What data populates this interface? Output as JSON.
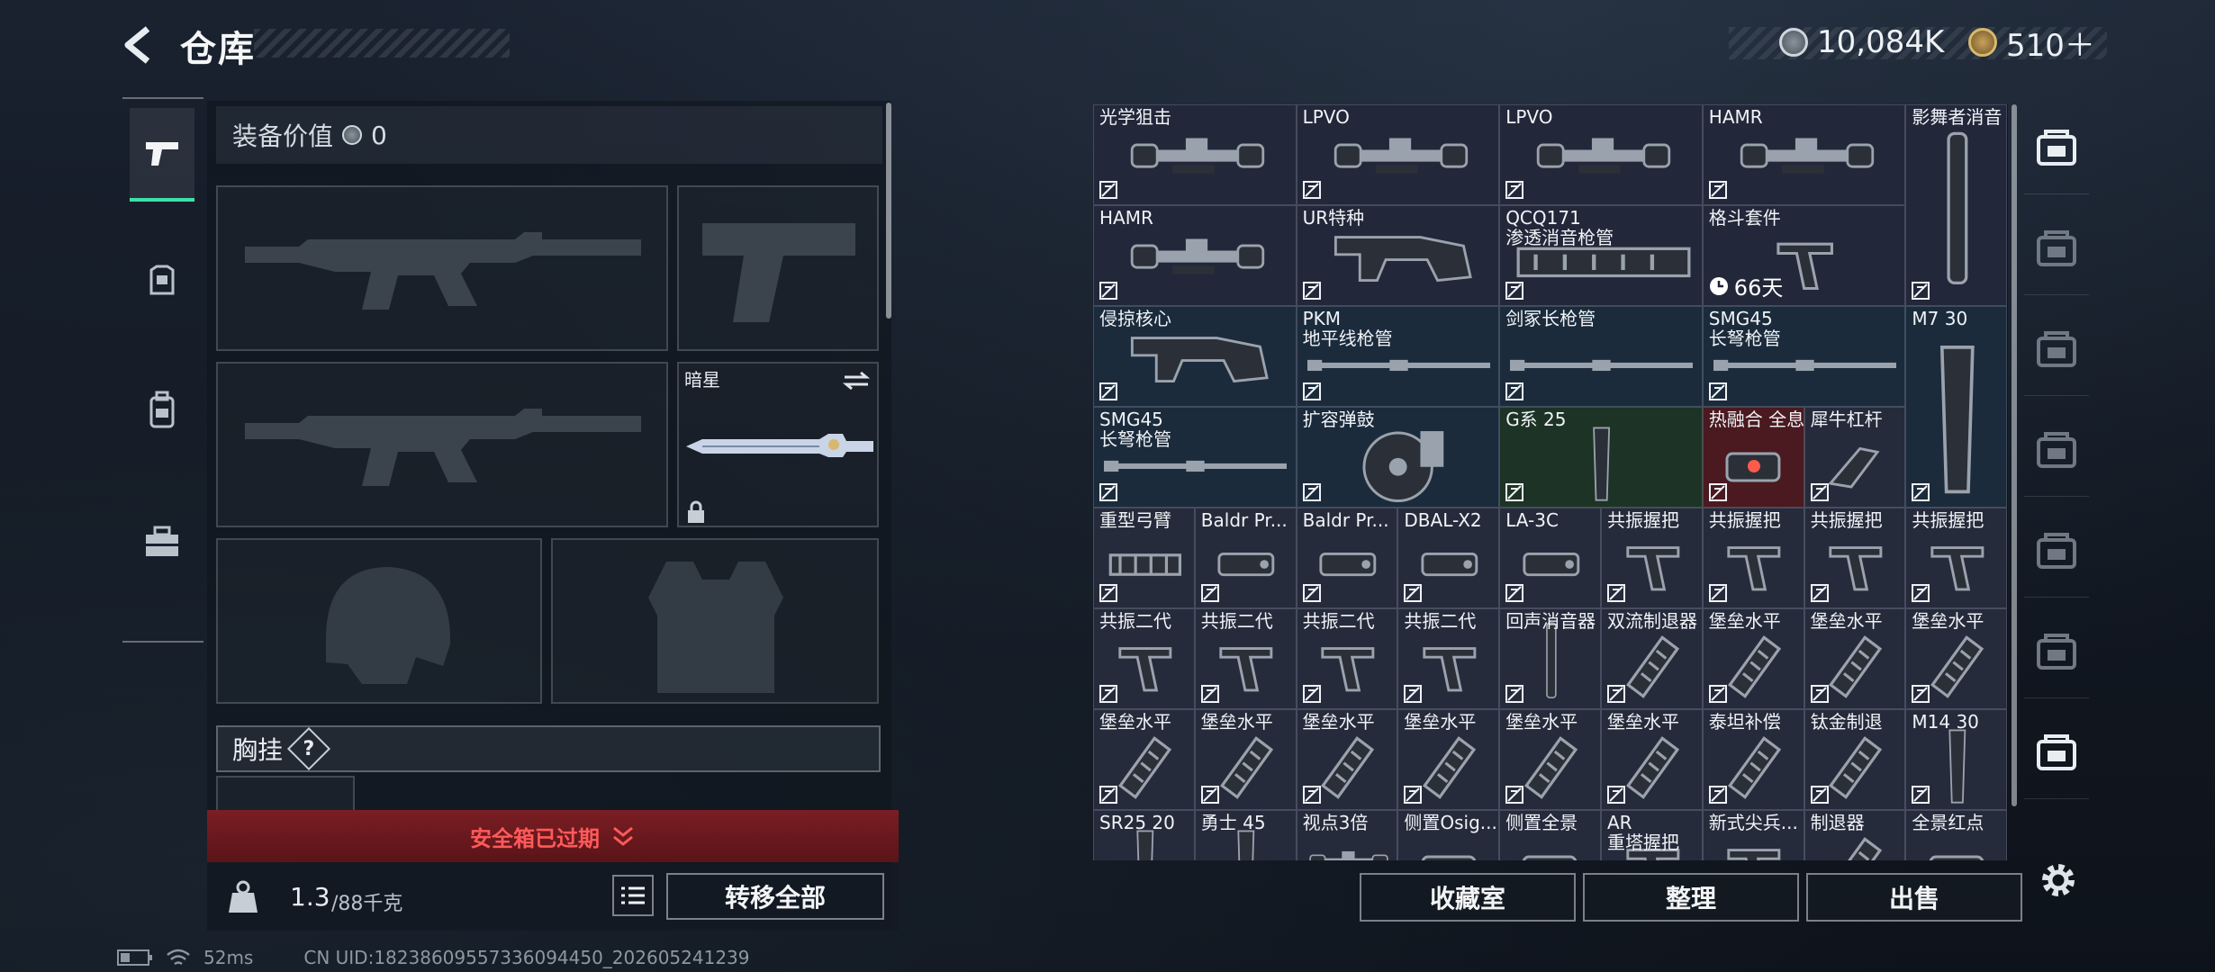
{
  "header": {
    "title": "仓库",
    "currency_silver": "10,084K",
    "currency_gold": "510＋"
  },
  "left_nav": [
    {
      "icon": "pistol-icon",
      "active": true
    },
    {
      "icon": "armor-icon",
      "active": false
    },
    {
      "icon": "backpack-icon",
      "active": false
    },
    {
      "icon": "toolbox-icon",
      "active": false
    }
  ],
  "loadout": {
    "equipment_value_label": "装备价值",
    "equipment_value": "0",
    "melee_name": "暗星",
    "chest_rig_label": "胸挂",
    "chest_rig_help": "?"
  },
  "safe_box": {
    "expired_text": "安全箱已过期"
  },
  "weight": {
    "current": "1.3",
    "max": "/88千克"
  },
  "buttons": {
    "transfer_all": "转移全部",
    "collection": "收藏室",
    "organize": "整理",
    "sell": "出售"
  },
  "grid_items": [
    {
      "n1": "光学狙击",
      "n2": "",
      "icon": "scope-icon"
    },
    {
      "n1": "LPVO",
      "n2": "",
      "icon": "scope-icon"
    },
    {
      "n1": "LPVO",
      "n2": "",
      "icon": "scope-icon"
    },
    {
      "n1": "HAMR",
      "n2": "",
      "icon": "scope-icon"
    },
    {
      "n1": "影舞者消音",
      "n2": "",
      "icon": "suppressor-icon"
    },
    {
      "n1": "HAMR",
      "n2": "",
      "icon": "scope-icon"
    },
    {
      "n1": "UR特种",
      "n2": "",
      "icon": "stock-icon"
    },
    {
      "n1": "QCQ171",
      "n2": "渗透消音枪管",
      "icon": "handguard-icon"
    },
    {
      "n1": "格斗套件",
      "n2": "",
      "icon": "grip-icon"
    },
    {
      "n1": "侵掠核心",
      "n2": "",
      "icon": "stock-icon"
    },
    {
      "n1": "PKM",
      "n2": "地平线枪管",
      "icon": "barrel-icon"
    },
    {
      "n1": "剑冢长枪管",
      "n2": "",
      "icon": "barrel-icon"
    },
    {
      "n1": "SMG45",
      "n2": "长弩枪管",
      "icon": "barrel-icon"
    },
    {
      "n1": "M7 30",
      "n2": "",
      "icon": "magazine-icon"
    },
    {
      "n1": "SMG45",
      "n2": "长弩枪管",
      "icon": "barrel-icon"
    },
    {
      "n1": "扩容弹鼓",
      "n2": "",
      "icon": "drum-icon"
    },
    {
      "n1": "G系 25",
      "n2": "",
      "icon": "magazine-icon"
    },
    {
      "n1": "热融合 全息",
      "n2": "",
      "icon": "sight-icon"
    },
    {
      "n1": "犀牛杠杆",
      "n2": "",
      "icon": "lever-icon"
    },
    {
      "n1": "重型弓臂",
      "n2": "",
      "icon": "rail-icon"
    },
    {
      "n1": "Baldr Pr...",
      "n2": "",
      "icon": "laser-icon"
    },
    {
      "n1": "Baldr Pr...",
      "n2": "",
      "icon": "laser-icon"
    },
    {
      "n1": "DBAL-X2",
      "n2": "",
      "icon": "laser-icon"
    },
    {
      "n1": "LA-3C",
      "n2": "",
      "icon": "laser-icon"
    },
    {
      "n1": "共振握把",
      "n2": "",
      "icon": "grip-icon"
    },
    {
      "n1": "共振握把",
      "n2": "",
      "icon": "grip-icon"
    },
    {
      "n1": "共振握把",
      "n2": "",
      "icon": "grip-icon"
    },
    {
      "n1": "共振握把",
      "n2": "",
      "icon": "grip-icon"
    },
    {
      "n1": "共振二代",
      "n2": "",
      "icon": "grip-icon"
    },
    {
      "n1": "共振二代",
      "n2": "",
      "icon": "grip-icon"
    },
    {
      "n1": "共振二代",
      "n2": "",
      "icon": "grip-icon"
    },
    {
      "n1": "共振二代",
      "n2": "",
      "icon": "grip-icon"
    },
    {
      "n1": "回声消音器",
      "n2": "",
      "icon": "suppressor-icon"
    },
    {
      "n1": "双流制退器",
      "n2": "",
      "icon": "muzzle-icon"
    },
    {
      "n1": "堡垒水平",
      "n2": "",
      "icon": "muzzle-icon"
    },
    {
      "n1": "堡垒水平",
      "n2": "",
      "icon": "muzzle-icon"
    },
    {
      "n1": "堡垒水平",
      "n2": "",
      "icon": "muzzle-icon"
    },
    {
      "n1": "堡垒水平",
      "n2": "",
      "icon": "muzzle-icon"
    },
    {
      "n1": "堡垒水平",
      "n2": "",
      "icon": "muzzle-icon"
    },
    {
      "n1": "堡垒水平",
      "n2": "",
      "icon": "muzzle-icon"
    },
    {
      "n1": "堡垒水平",
      "n2": "",
      "icon": "muzzle-icon"
    },
    {
      "n1": "堡垒水平",
      "n2": "",
      "icon": "muzzle-icon"
    },
    {
      "n1": "堡垒水平",
      "n2": "",
      "icon": "muzzle-icon"
    },
    {
      "n1": "泰坦补偿",
      "n2": "",
      "icon": "muzzle-icon"
    },
    {
      "n1": "钛金制退",
      "n2": "",
      "icon": "muzzle-icon"
    },
    {
      "n1": "M14 30",
      "n2": "",
      "icon": "magazine-icon"
    },
    {
      "n1": "SR25 20",
      "n2": "",
      "icon": "magazine-icon"
    },
    {
      "n1": "勇士 45",
      "n2": "",
      "icon": "magazine-icon"
    },
    {
      "n1": "视点3倍",
      "n2": "",
      "icon": "scope-icon"
    },
    {
      "n1": "侧置Osig...",
      "n2": "",
      "icon": "sight-icon"
    },
    {
      "n1": "侧置全景",
      "n2": "",
      "icon": "sight-icon"
    },
    {
      "n1": "AR",
      "n2": "重塔握把",
      "icon": "grip-icon"
    },
    {
      "n1": "新式尖兵...",
      "n2": "",
      "icon": "grip-icon"
    },
    {
      "n1": "制退器",
      "n2": "",
      "icon": "muzzle-icon"
    },
    {
      "n1": "全景红点",
      "n2": "",
      "icon": "sight-icon"
    }
  ],
  "timer_text": "66天",
  "right_nav": [
    "bunker-icon",
    "gti-cases-icon",
    "v-case-icon",
    "gti-case-icon",
    "iv-case-icon",
    "iv-plus-icon",
    "iv-weapon-icon"
  ],
  "footer": {
    "ping": "52ms",
    "uid": "CN UID:1823860955733609445​0_202605241239"
  }
}
